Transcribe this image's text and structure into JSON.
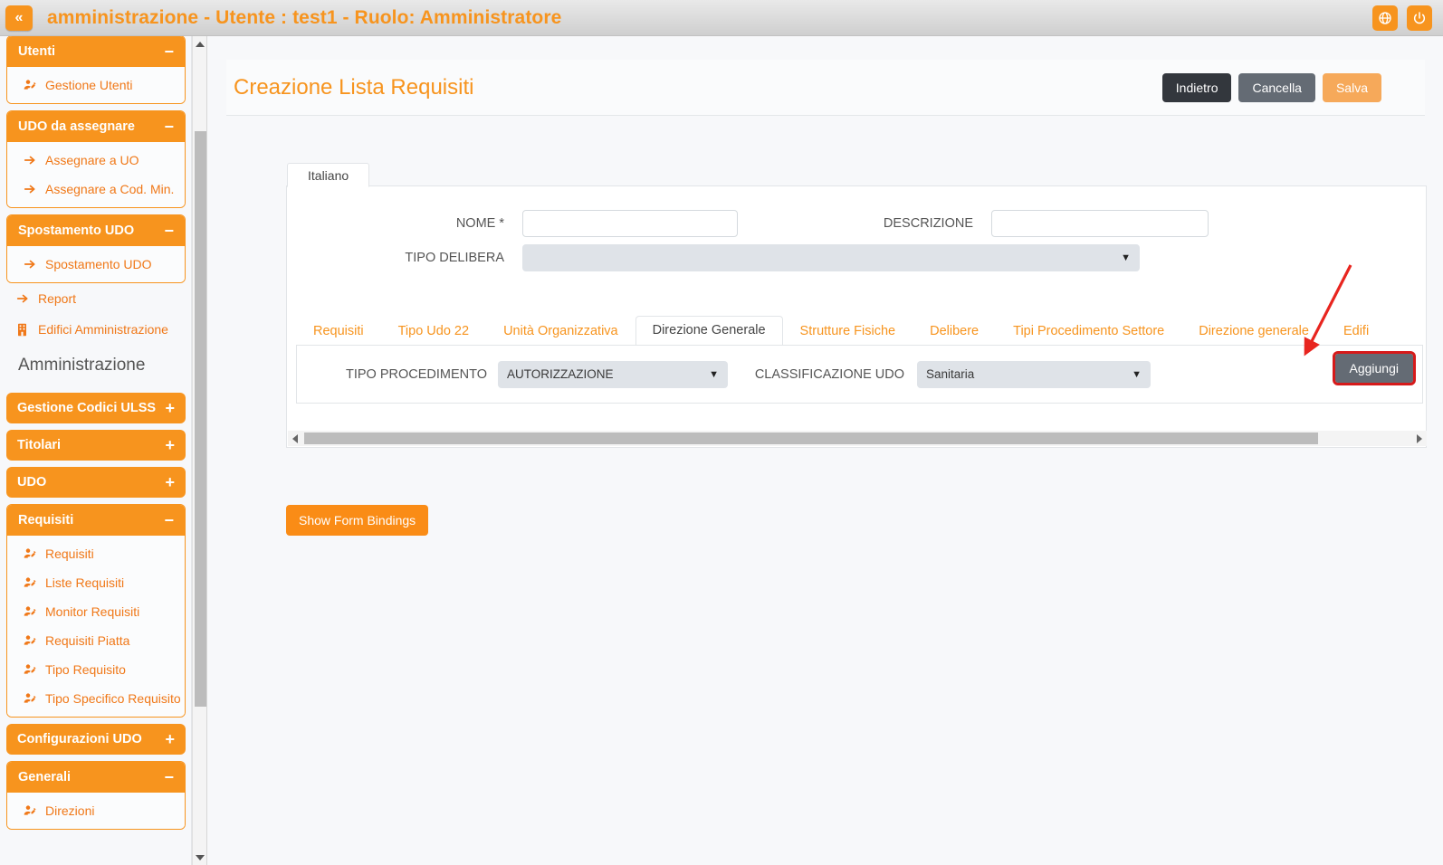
{
  "topbar": {
    "collapse_label": "«",
    "title": "amministrazione - Utente : test1 - Ruolo: Amministratore",
    "language_icon": "globe-icon",
    "logout_icon": "power-icon",
    "accent": "#f7941e"
  },
  "sidebar": {
    "section_title": "Amministrazione",
    "panels": [
      {
        "label": "Utenti",
        "sign": "−",
        "open": true,
        "items": [
          {
            "label": "Gestione Utenti",
            "icon": "user-edit-icon"
          }
        ]
      },
      {
        "label": "UDO da assegnare",
        "sign": "−",
        "open": true,
        "items": [
          {
            "label": "Assegnare a UO",
            "icon": "arrow-right-icon"
          },
          {
            "label": "Assegnare a Cod. Min.",
            "icon": "arrow-right-icon"
          }
        ]
      },
      {
        "label": "Spostamento UDO",
        "sign": "−",
        "open": true,
        "items": [
          {
            "label": "Spostamento UDO",
            "icon": "arrow-right-icon"
          }
        ]
      }
    ],
    "free_items": [
      {
        "label": "Report",
        "icon": "arrow-right-icon"
      },
      {
        "label": "Edifici Amministrazione",
        "icon": "building-icon"
      }
    ],
    "panels2": [
      {
        "label": "Gestione Codici ULSS",
        "sign": "+",
        "open": false,
        "items": []
      },
      {
        "label": "Titolari",
        "sign": "+",
        "open": false,
        "items": []
      },
      {
        "label": "UDO",
        "sign": "+",
        "open": false,
        "items": []
      },
      {
        "label": "Requisiti",
        "sign": "−",
        "open": true,
        "items": [
          {
            "label": "Requisiti",
            "icon": "user-edit-icon"
          },
          {
            "label": "Liste Requisiti",
            "icon": "user-edit-icon"
          },
          {
            "label": "Monitor Requisiti",
            "icon": "user-edit-icon"
          },
          {
            "label": "Requisiti Piatta",
            "icon": "user-edit-icon"
          },
          {
            "label": "Tipo Requisito",
            "icon": "user-edit-icon"
          },
          {
            "label": "Tipo Specifico Requisito",
            "icon": "user-edit-icon"
          }
        ]
      },
      {
        "label": "Configurazioni UDO",
        "sign": "+",
        "open": false,
        "items": []
      },
      {
        "label": "Generali",
        "sign": "−",
        "open": true,
        "items": [
          {
            "label": "Direzioni",
            "icon": "user-edit-icon"
          }
        ]
      }
    ]
  },
  "page": {
    "title": "Creazione Lista Requisiti",
    "buttons": {
      "back": "Indietro",
      "cancel": "Cancella",
      "save": "Salva"
    }
  },
  "form": {
    "language_tab": "Italiano",
    "nome_label": "NOME *",
    "nome_value": "",
    "descrizione_label": "DESCRIZIONE",
    "descrizione_value": "",
    "tipo_delibera_label": "TIPO DELIBERA",
    "tipo_delibera_value": "",
    "caret": "▼"
  },
  "tabs": [
    {
      "label": "Requisiti",
      "active": false
    },
    {
      "label": "Tipo Udo 22",
      "active": false
    },
    {
      "label": "Unità Organizzativa",
      "active": false
    },
    {
      "label": "Direzione Generale",
      "active": true
    },
    {
      "label": "Strutture Fisiche",
      "active": false
    },
    {
      "label": "Delibere",
      "active": false
    },
    {
      "label": "Tipi Procedimento Settore",
      "active": false
    },
    {
      "label": "Direzione generale",
      "active": false
    },
    {
      "label": "Edifi",
      "active": false
    }
  ],
  "tabpanel": {
    "tipo_procedimento_label": "TIPO PROCEDIMENTO",
    "tipo_procedimento_value": "AUTORIZZAZIONE",
    "classificazione_udo_label": "CLASSIFICAZIONE UDO",
    "classificazione_udo_value": "Sanitaria",
    "add_button": "Aggiungi",
    "highlight_color": "#d61a1a"
  },
  "footer": {
    "show_bindings": "Show Form Bindings"
  }
}
